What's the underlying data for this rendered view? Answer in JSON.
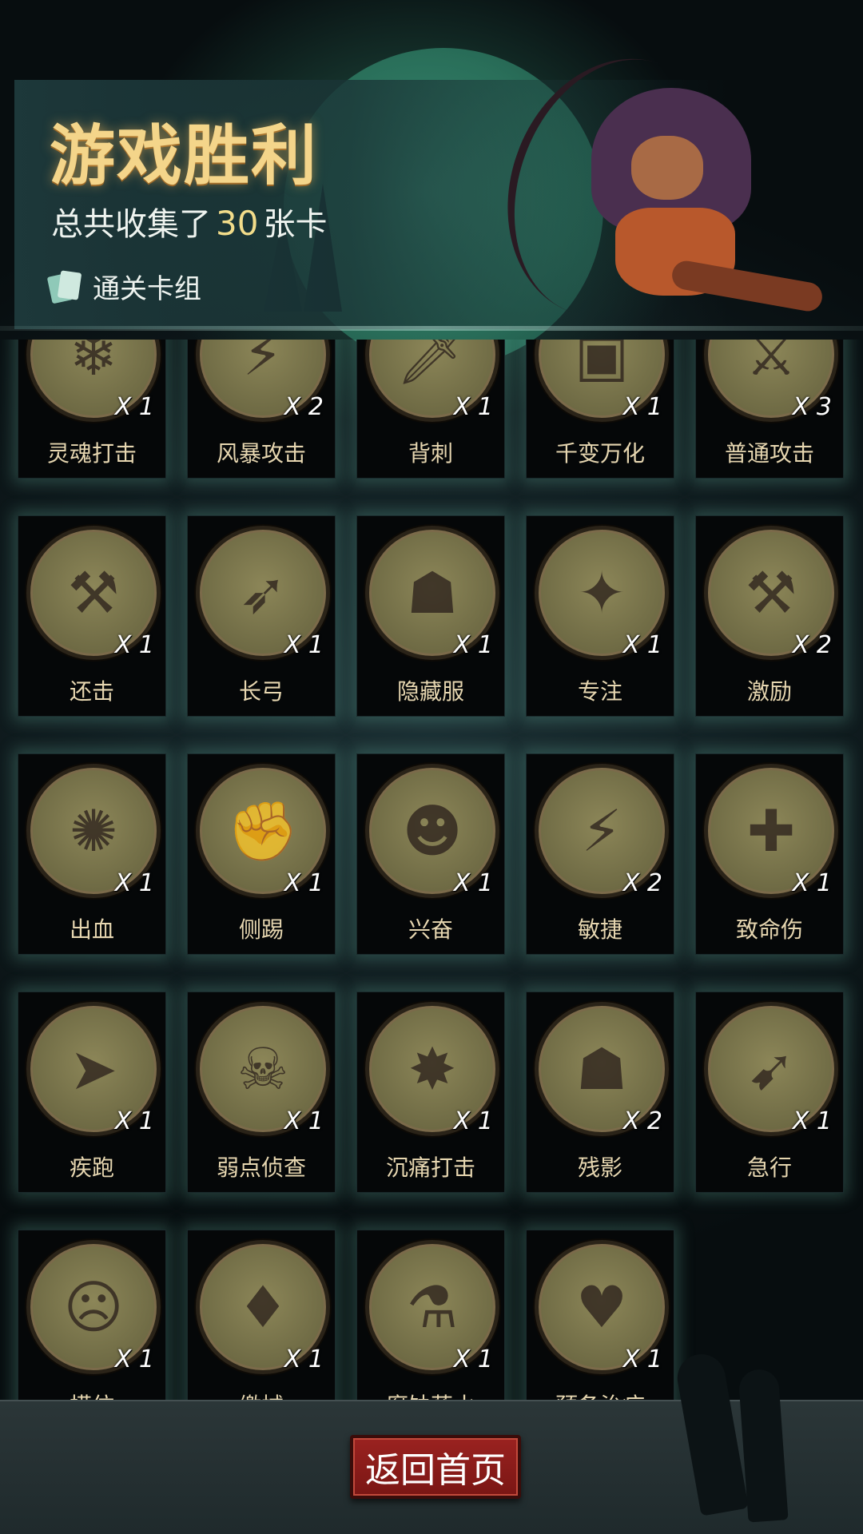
{
  "header": {
    "title": "游戏胜利",
    "collected_prefix": "总共收集了",
    "collected_count": "30",
    "collected_suffix": "张卡",
    "deck_label": "通关卡组"
  },
  "cards": [
    {
      "name": "灵魂打击",
      "count": "X 1",
      "icon": "ice-shard-icon"
    },
    {
      "name": "风暴攻击",
      "count": "X 2",
      "icon": "storm-icon"
    },
    {
      "name": "背刺",
      "count": "X 1",
      "icon": "backstab-icon"
    },
    {
      "name": "千变万化",
      "count": "X 1",
      "icon": "shapeshift-box-icon"
    },
    {
      "name": "普通攻击",
      "count": "X 3",
      "icon": "sword-strike-icon"
    },
    {
      "name": "还击",
      "count": "X 1",
      "icon": "counter-warrior-icon"
    },
    {
      "name": "长弓",
      "count": "X 1",
      "icon": "longbow-icon"
    },
    {
      "name": "隐藏服",
      "count": "X 1",
      "icon": "hood-cloak-icon"
    },
    {
      "name": "专注",
      "count": "X 1",
      "icon": "wizard-icon"
    },
    {
      "name": "激励",
      "count": "X 2",
      "icon": "hammer-brute-icon"
    },
    {
      "name": "出血",
      "count": "X 1",
      "icon": "octopus-icon"
    },
    {
      "name": "侧踢",
      "count": "X 1",
      "icon": "kick-monk-icon"
    },
    {
      "name": "兴奋",
      "count": "X 1",
      "icon": "excited-miner-icon"
    },
    {
      "name": "敏捷",
      "count": "X 2",
      "icon": "panther-icon"
    },
    {
      "name": "致命伤",
      "count": "X 1",
      "icon": "bleeding-dagger-icon"
    },
    {
      "name": "疾跑",
      "count": "X 1",
      "icon": "running-wolf-icon"
    },
    {
      "name": "弱点侦查",
      "count": "X 1",
      "icon": "werewolf-icon"
    },
    {
      "name": "沉痛打击",
      "count": "X 1",
      "icon": "ogre-smash-icon"
    },
    {
      "name": "残影",
      "count": "X 2",
      "icon": "hooded-clones-icon"
    },
    {
      "name": "急行",
      "count": "X 1",
      "icon": "dashing-dwarf-icon"
    },
    {
      "name": "模仿",
      "count": "X 1",
      "icon": "troll-face-icon"
    },
    {
      "name": "缴械",
      "count": "X 1",
      "icon": "disarm-shield-icon"
    },
    {
      "name": "腐蚀药水",
      "count": "X 1",
      "icon": "potion-icon"
    },
    {
      "name": "预备治疗",
      "count": "X 1",
      "icon": "heart-cross-icon"
    }
  ],
  "footer": {
    "home_button_label": "返回首页"
  },
  "colors": {
    "title_gold": "#f4d58a",
    "card_name": "#e6d6b0",
    "button_red": "#9a2220",
    "card_glow": "#6ebea a"
  }
}
